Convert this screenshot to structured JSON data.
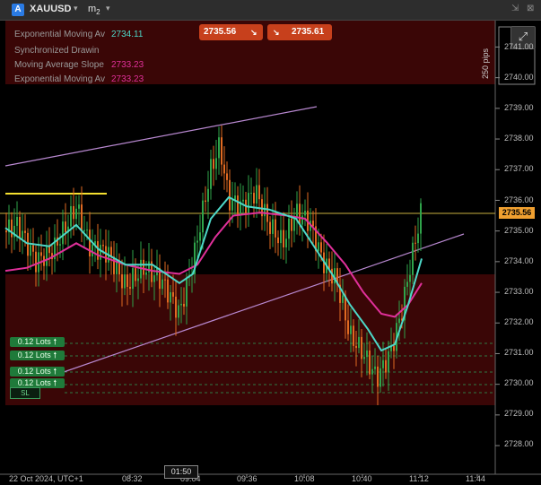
{
  "window": {
    "symbol": "XAUUSD",
    "symbol_icon": "A",
    "timeframe": "m",
    "timeframe_sub": "2",
    "dropdown_glyph": "▾",
    "restore_glyph": "⇲",
    "close_glyph": "⊠",
    "expand_glyph": "⤢"
  },
  "legend": [
    {
      "name": "Exponential Moving Av",
      "value": "2734.11",
      "color": "#4dd8c8"
    },
    {
      "name": "Synchronized Drawin",
      "value": "",
      "color": "#9a9a9a"
    },
    {
      "name": "Moving Average Slope",
      "value": "2733.23",
      "color": "#e0309a"
    },
    {
      "name": "Exponential Moving Av",
      "value": "2733.23",
      "color": "#e0309a"
    }
  ],
  "prices": {
    "sell": "2735.56",
    "buy": "2735.61",
    "sell_icon": "↘",
    "buy_icon": "↘",
    "current": "2735.56",
    "pips_label": "250 pips"
  },
  "lots": [
    {
      "label": "0.12 Lots",
      "arrow": "🠕"
    },
    {
      "label": "0.12 Lots",
      "arrow": "🠕"
    },
    {
      "label": "0.12 Lots",
      "arrow": "🠕"
    },
    {
      "label": "0.12 Lots",
      "arrow": "🠕"
    }
  ],
  "sl_label": "SL",
  "y_axis": [
    "2741.00",
    "2740.00",
    "2739.00",
    "2738.00",
    "2737.00",
    "2736.00",
    "2735.00",
    "2734.00",
    "2733.00",
    "2732.00",
    "2731.00",
    "2730.00",
    "2729.00",
    "2728.00"
  ],
  "x_axis": {
    "date_label": "22 Oct 2024, UTC+1",
    "ticks": [
      "08:32",
      "09:04",
      "09:36",
      "10:08",
      "10:40",
      "11:12",
      "11:44"
    ],
    "cursor_time": "01:50"
  },
  "colors": {
    "background": "#000000",
    "zone_red": "#3a0606",
    "ema_fast": "#4dd8c8",
    "ema_slow": "#e0309a",
    "channel": "#b888d0",
    "bull_candle": "#2fa34a",
    "bear_candle": "#e06a22",
    "price_line": "#c9b040",
    "level_line": "#f5e030"
  }
}
